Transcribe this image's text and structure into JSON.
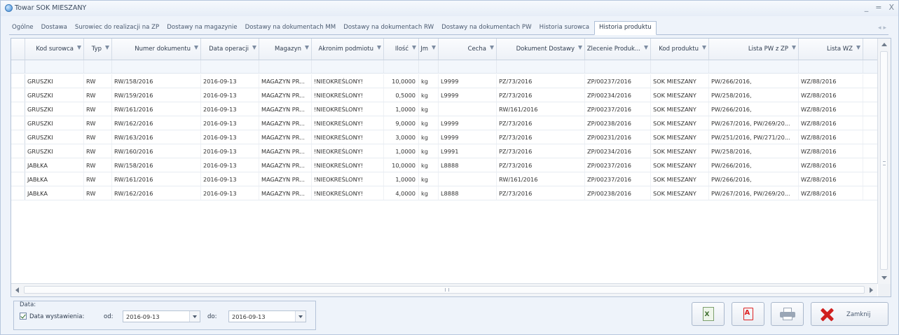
{
  "window": {
    "title": "Towar SOK MIESZANY",
    "controls": [
      "_",
      "=",
      "X"
    ]
  },
  "tabs": [
    {
      "label": "Ogólne",
      "active": false
    },
    {
      "label": "Dostawa",
      "active": false
    },
    {
      "label": "Surowiec do realizacji na ZP",
      "active": false
    },
    {
      "label": "Dostawy na magazynie",
      "active": false
    },
    {
      "label": "Dostawy na dokumentach MM",
      "active": false
    },
    {
      "label": "Dostawy na dokumentach RW",
      "active": false
    },
    {
      "label": "Dostawy na dokumentach PW",
      "active": false
    },
    {
      "label": "Historia surowca",
      "active": false
    },
    {
      "label": "Historia produktu",
      "active": true
    }
  ],
  "grid": {
    "columns": [
      {
        "label": "Kod surowca"
      },
      {
        "label": "Typ"
      },
      {
        "label": "Numer dokumentu"
      },
      {
        "label": "Data operacji"
      },
      {
        "label": "Magazyn"
      },
      {
        "label": "Akronim podmiotu"
      },
      {
        "label": "Ilość"
      },
      {
        "label": "Jm"
      },
      {
        "label": "Cecha"
      },
      {
        "label": "Dokument Dostawy"
      },
      {
        "label": "Zlecenie Produk..."
      },
      {
        "label": "Kod produktu"
      },
      {
        "label": "Lista PW z ZP"
      },
      {
        "label": "Lista WZ"
      }
    ],
    "rows": [
      [
        "GRUSZKI",
        "RW",
        "RW/158/2016",
        "2016-09-13",
        "MAGAZYN PR...",
        "!NIEOKREŚLONY!",
        "10,0000",
        "kg",
        "L9999",
        "PZ/73/2016",
        "ZP/00237/2016",
        "SOK MIESZANY",
        "PW/266/2016,",
        "WZ/88/2016"
      ],
      [
        "GRUSZKI",
        "RW",
        "RW/159/2016",
        "2016-09-13",
        "MAGAZYN PR...",
        "!NIEOKREŚLONY!",
        "0,5000",
        "kg",
        "L9999",
        "PZ/73/2016",
        "ZP/00234/2016",
        "SOK MIESZANY",
        "PW/258/2016,",
        "WZ/88/2016"
      ],
      [
        "GRUSZKI",
        "RW",
        "RW/161/2016",
        "2016-09-13",
        "MAGAZYN PR...",
        "!NIEOKREŚLONY!",
        "1,0000",
        "kg",
        "",
        "RW/161/2016",
        "ZP/00237/2016",
        "SOK MIESZANY",
        "PW/266/2016,",
        "WZ/88/2016"
      ],
      [
        "GRUSZKI",
        "RW",
        "RW/162/2016",
        "2016-09-13",
        "MAGAZYN PR...",
        "!NIEOKREŚLONY!",
        "9,0000",
        "kg",
        "L9999",
        "PZ/73/2016",
        "ZP/00238/2016",
        "SOK MIESZANY",
        "PW/267/2016,  PW/269/20...",
        "WZ/88/2016"
      ],
      [
        "GRUSZKI",
        "RW",
        "RW/163/2016",
        "2016-09-13",
        "MAGAZYN PR...",
        "!NIEOKREŚLONY!",
        "3,0000",
        "kg",
        "L9999",
        "PZ/73/2016",
        "ZP/00231/2016",
        "SOK MIESZANY",
        "PW/251/2016,  PW/271/20...",
        "WZ/88/2016"
      ],
      [
        "GRUSZKI",
        "RW",
        "RW/160/2016",
        "2016-09-13",
        "MAGAZYN PR...",
        "!NIEOKREŚLONY!",
        "1,0000",
        "kg",
        "L9991",
        "PZ/73/2016",
        "ZP/00234/2016",
        "SOK MIESZANY",
        "PW/258/2016,",
        "WZ/88/2016"
      ],
      [
        "JABŁKA",
        "RW",
        "RW/158/2016",
        "2016-09-13",
        "MAGAZYN PR...",
        "!NIEOKREŚLONY!",
        "10,0000",
        "kg",
        "L8888",
        "PZ/73/2016",
        "ZP/00237/2016",
        "SOK MIESZANY",
        "PW/266/2016,",
        "WZ/88/2016"
      ],
      [
        "JABŁKA",
        "RW",
        "RW/161/2016",
        "2016-09-13",
        "MAGAZYN PR...",
        "!NIEOKREŚLONY!",
        "1,0000",
        "kg",
        "",
        "RW/161/2016",
        "ZP/00237/2016",
        "SOK MIESZANY",
        "PW/266/2016,",
        "WZ/88/2016"
      ],
      [
        "JABŁKA",
        "RW",
        "RW/162/2016",
        "2016-09-13",
        "MAGAZYN PR...",
        "!NIEOKREŚLONY!",
        "4,0000",
        "kg",
        "L8888",
        "PZ/73/2016",
        "ZP/00238/2016",
        "SOK MIESZANY",
        "PW/267/2016,  PW/269/20...",
        "WZ/88/2016"
      ]
    ]
  },
  "date_filter": {
    "group_title": "Data:",
    "checkbox_label": "Data wystawienia:",
    "checked": true,
    "from_label": "od:",
    "from_value": "2016-09-13",
    "to_label": "do:",
    "to_value": "2016-09-13"
  },
  "buttons": {
    "close_label": "Zamknij",
    "excel_icon": "excel-export-icon",
    "pdf_icon": "pdf-export-icon",
    "print_icon": "printer-icon",
    "close_icon": "close-x-icon",
    "close_color": "#d0201f"
  }
}
